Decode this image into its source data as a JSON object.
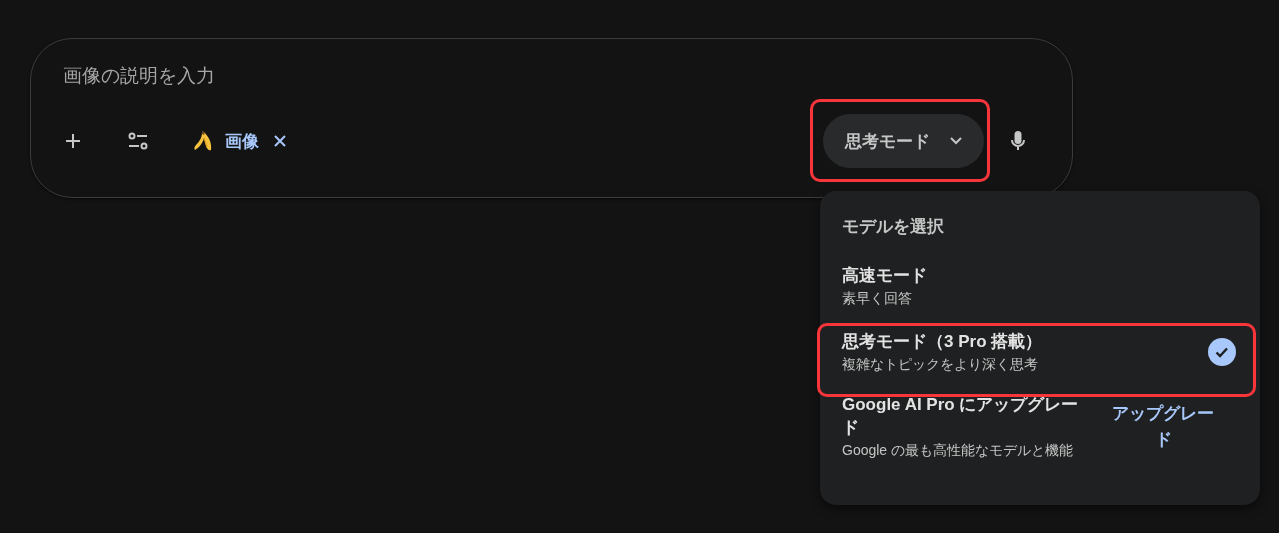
{
  "prompt": {
    "placeholder": "画像の説明を入力"
  },
  "chip": {
    "label": "画像"
  },
  "mode_button": {
    "label": "思考モード",
    "highlighted": true,
    "expanded": true
  },
  "menu": {
    "title": "モデルを選択",
    "items": [
      {
        "kind": "option",
        "title": "高速モード",
        "subtitle": "素早く回答",
        "selected": false,
        "highlighted": false
      },
      {
        "kind": "option",
        "title": "思考モード（3 Pro 搭載）",
        "subtitle": "複雑なトピックをより深く思考",
        "selected": true,
        "highlighted": true
      },
      {
        "kind": "upgrade",
        "title": "Google AI Pro にアップグレード",
        "subtitle": "Google の最も高性能なモデルと機能",
        "action": "アップグレード"
      }
    ]
  }
}
